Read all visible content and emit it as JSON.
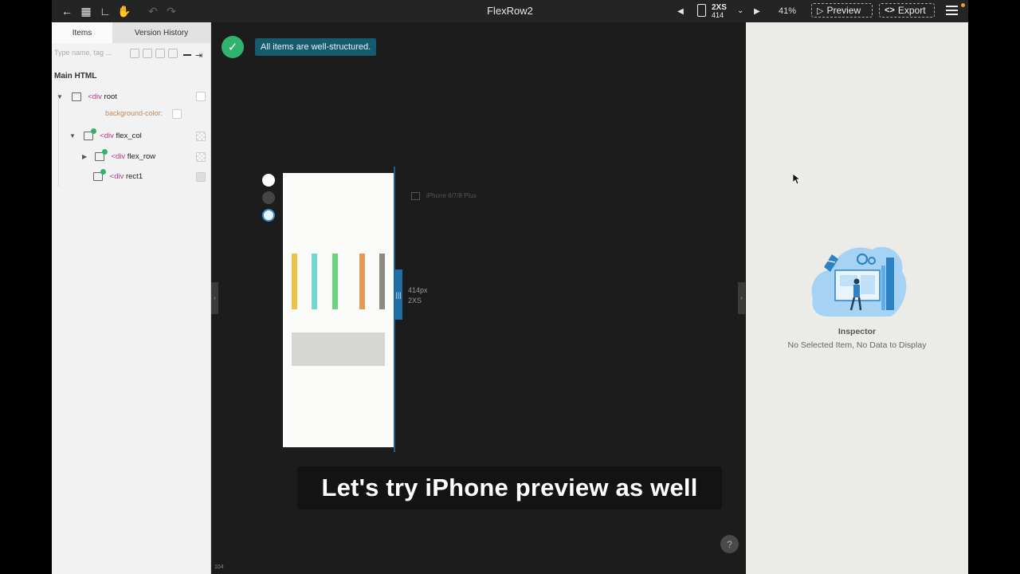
{
  "window": {
    "title": "FlexRow2"
  },
  "toolbar": {
    "device_size": "2XS",
    "device_width": "414",
    "zoom": "41%",
    "preview_label": "Preview",
    "export_label": "Export"
  },
  "left_panel": {
    "tabs": [
      {
        "label": "Items"
      },
      {
        "label": "Version History"
      }
    ],
    "search_placeholder": "Type name, tag ...",
    "section_title": "Main HTML",
    "tree": {
      "root": {
        "tag": "<div",
        "name": "root"
      },
      "prop": "background-color:",
      "flex_col": {
        "tag": "<div",
        "name": "flex_col"
      },
      "flex_row": {
        "tag": "<div",
        "name": "flex_row"
      },
      "rect1": {
        "tag": "<div",
        "name": "rect1"
      }
    }
  },
  "canvas": {
    "toast": "All items are well-structured.",
    "size_px": "414px",
    "size_name": "2XS",
    "device_name": "iPhone 6/7/8 Plus",
    "bar_colors": [
      "#e9c34a",
      "#6fd8d0",
      "#6dd47e",
      "#e49a52",
      "#8c8c84"
    ],
    "rect1_color": "#d6d6d3",
    "accent": "#1e6fa3",
    "footer_number": "104"
  },
  "inspector": {
    "title": "Inspector",
    "message": "No Selected Item, No Data to Display"
  },
  "caption": "Let's try iPhone preview as well"
}
